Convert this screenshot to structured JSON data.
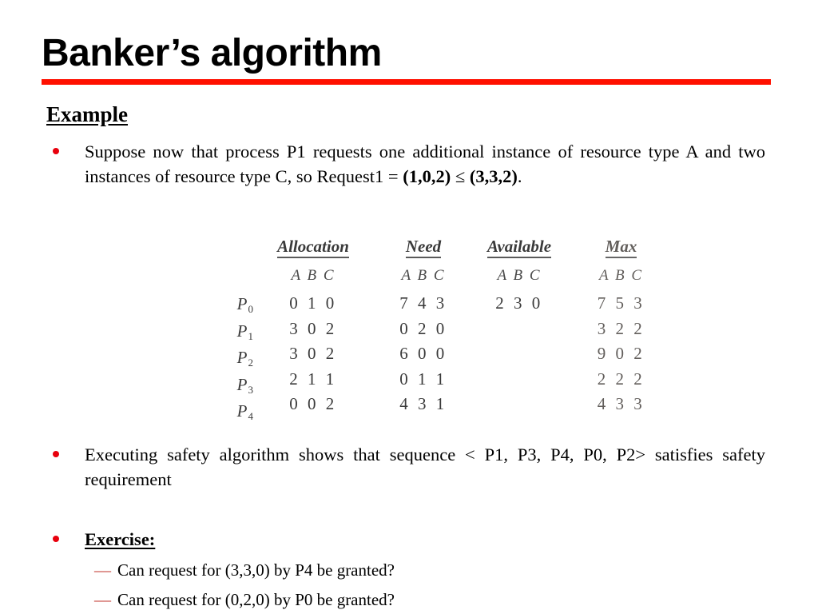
{
  "slide": {
    "title": "Banker’s algorithm",
    "rule_color": "#FF1000",
    "bullet_color": "#E8000D",
    "dash_color": "#C03028"
  },
  "section": {
    "heading": "Example"
  },
  "bullets": [
    {
      "id": "bullet-1",
      "marker": "dot",
      "text_parts": [
        {
          "text": "Suppose now that process P1 requests one additional instance of resource type A and two instances of resource type C, so Request1 = ",
          "bold": false
        },
        {
          "text": "(1,0,2)",
          "bold": true
        },
        {
          "text": " ≤ ",
          "bold": false
        },
        {
          "text": "(3,3,2)",
          "bold": true
        },
        {
          "text": ".",
          "bold": false
        }
      ],
      "plain": "Suppose now that process P1 requests one additional instance of resource type A and two instances of resource type C, so Request1 = (1,0,2) ≤ (3,3,2)."
    },
    {
      "id": "bullet-2",
      "marker": "dot",
      "plain": "Executing safety algorithm shows that sequence < P1, P3, P4, P0, P2> satisfies safety requirement"
    },
    {
      "id": "bullet-3",
      "marker": "dot",
      "plain": "Exercise:"
    }
  ],
  "subbullets": [
    {
      "dash": "—",
      "text": "Can request for (3,3,0) by P4 be granted?"
    },
    {
      "dash": "—",
      "text": "Can request for (0,2,0) by P0 be granted?"
    }
  ],
  "table": {
    "column_headers": [
      "Allocation",
      "Need",
      "Available",
      "Max"
    ],
    "resource_header": "A B C",
    "process_labels": [
      {
        "base": "P",
        "sub": "0"
      },
      {
        "base": "P",
        "sub": "1"
      },
      {
        "base": "P",
        "sub": "2"
      },
      {
        "base": "P",
        "sub": "3"
      },
      {
        "base": "P",
        "sub": "4"
      }
    ],
    "allocation": [
      "0 1 0",
      "3 0 2",
      "3 0 2",
      "2 1 1",
      "0 0 2"
    ],
    "need": [
      "7 4 3",
      "0 2 0",
      "6 0 0",
      "0 1 1",
      "4 3 1"
    ],
    "available": [
      "2 3 0"
    ],
    "max": [
      "7 5 3",
      "3 2 2",
      "9 0 2",
      "2 2 2",
      "4 3 3"
    ]
  }
}
